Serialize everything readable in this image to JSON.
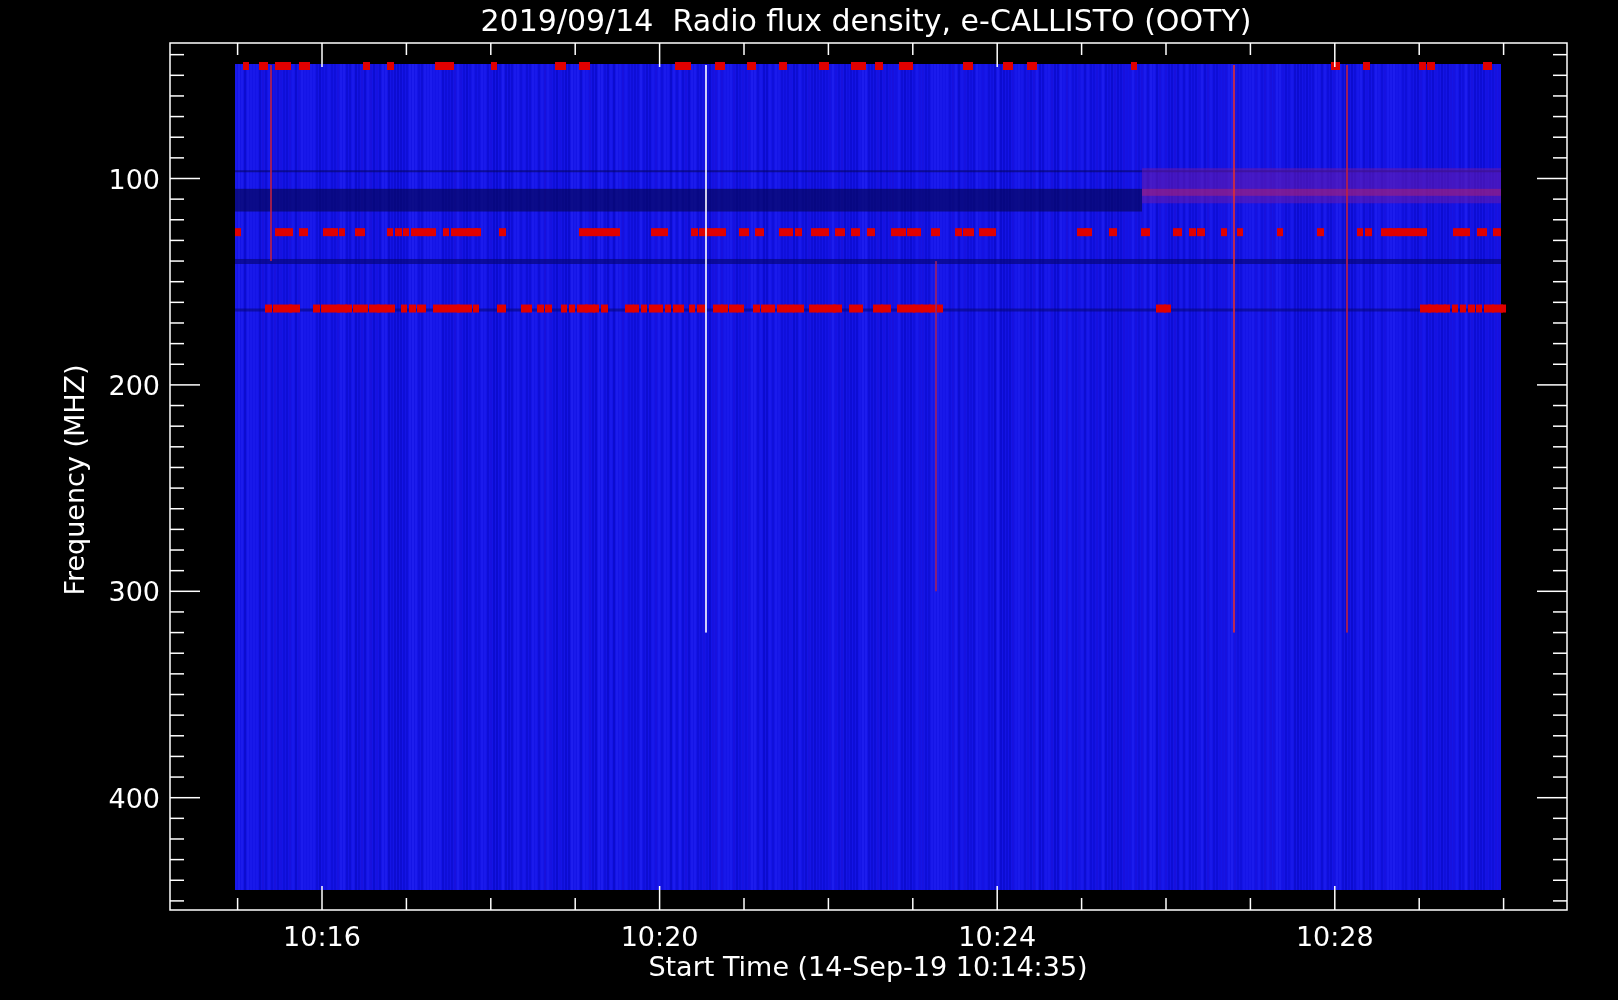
{
  "title": "2019/09/14  Radio flux density, e-CALLISTO (OOTY)",
  "y_axis": {
    "label": "Frequency (MHZ)",
    "ticks": [
      "100",
      "200",
      "300",
      "400"
    ]
  },
  "x_axis": {
    "label": "Start Time (14-Sep-19 10:14:35)",
    "ticks": [
      "10:16",
      "10:20",
      "10:24",
      "10:28"
    ]
  }
}
